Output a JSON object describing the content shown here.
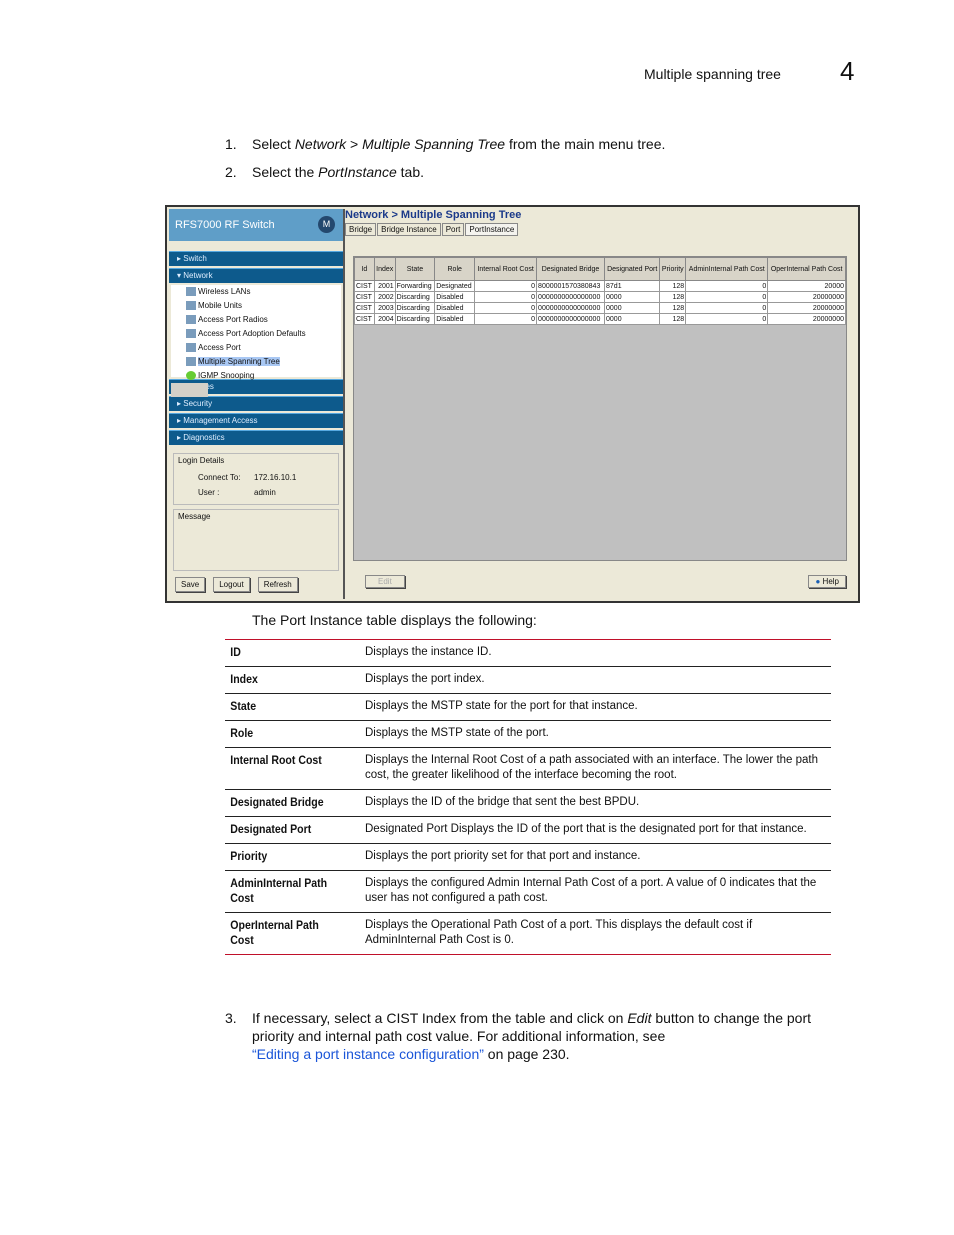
{
  "header": {
    "title": "Multiple spanning tree",
    "chapter": "4"
  },
  "steps": [
    {
      "n": "1.",
      "pre": "Select ",
      "em1": "Network",
      "mid": " > ",
      "em2": "Multiple Spanning Tree",
      "post": " from the main menu tree."
    },
    {
      "n": "2.",
      "pre": "Select the ",
      "em1": "PortInstance",
      "post": " tab."
    }
  ],
  "app": {
    "brand": "RFS7000 RF Switch",
    "logo": "M",
    "nav": [
      "Switch",
      "Network",
      "Services",
      "Security",
      "Management Access",
      "Diagnostics"
    ],
    "tree": [
      "Wireless LANs",
      "Mobile Units",
      "Access Port Radios",
      "Access Port Adoption Defaults",
      "Access Port",
      "Multiple Spanning Tree",
      "IGMP Snooping"
    ],
    "login": {
      "legend": "Login Details",
      "connect_label": "Connect To:",
      "connect": "172.16.10.1",
      "user_label": "User :",
      "user": "admin"
    },
    "message_legend": "Message",
    "buttons": {
      "save": "Save",
      "logout": "Logout",
      "refresh": "Refresh",
      "edit": "Edit",
      "help": "Help"
    },
    "title": "Network > Multiple Spanning Tree",
    "tabs": [
      "Bridge",
      "Bridge Instance",
      "Port",
      "PortInstance"
    ],
    "columns": [
      "Id",
      "Index",
      "State",
      "Role",
      "Internal Root Cost",
      "Designated Bridge",
      "Designated Port",
      "Priority",
      "AdminInternal Path Cost",
      "OperInternal Path Cost"
    ],
    "rows": [
      [
        "CIST",
        "2001",
        "Forwarding",
        "Designated",
        "0",
        "8000001570380843",
        "87d1",
        "128",
        "0",
        "20000"
      ],
      [
        "CIST",
        "2002",
        "Discarding",
        "Disabled",
        "0",
        "0000000000000000",
        "0000",
        "128",
        "0",
        "20000000"
      ],
      [
        "CIST",
        "2003",
        "Discarding",
        "Disabled",
        "0",
        "0000000000000000",
        "0000",
        "128",
        "0",
        "20000000"
      ],
      [
        "CIST",
        "2004",
        "Discarding",
        "Disabled",
        "0",
        "0000000000000000",
        "0000",
        "128",
        "0",
        "20000000"
      ]
    ]
  },
  "intro": "The Port Instance table displays the following:",
  "definitions": [
    [
      "ID",
      "Displays the instance ID."
    ],
    [
      "Index",
      "Displays the port index."
    ],
    [
      "State",
      "Displays the MSTP state for the port for that instance."
    ],
    [
      "Role",
      "Displays the MSTP state of the port."
    ],
    [
      "Internal Root Cost",
      "Displays the Internal Root Cost of a path associated with an interface. The lower the path cost, the greater likelihood of the interface becoming the root."
    ],
    [
      "Designated Bridge",
      "Displays the ID of the bridge that sent the best BPDU."
    ],
    [
      "Designated Port",
      "Designated Port Displays the ID of the port that is the designated port for that instance."
    ],
    [
      "Priority",
      "Displays the port priority set for that port and instance."
    ],
    [
      "AdminInternal Path Cost",
      "Displays the configured Admin Internal Path Cost of a port. A value of 0 indicates that the user has not configured a path cost."
    ],
    [
      "OperInternal Path Cost",
      "Displays the Operational Path Cost of a port. This displays the default cost if AdminInternal Path Cost is 0."
    ]
  ],
  "step3": {
    "n": "3.",
    "pre": "If necessary, select a CIST Index from the table and click on ",
    "em": "Edit",
    "post": " button to change the port priority and internal path cost value. For additional information, see",
    "link": "“Editing a port instance configuration”",
    "tail": " on page 230."
  }
}
